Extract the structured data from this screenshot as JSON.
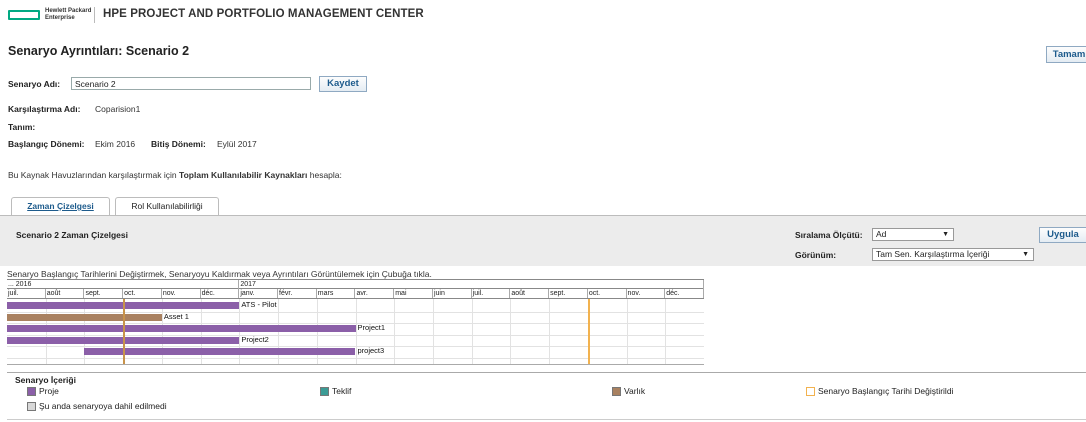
{
  "header": {
    "logo_text_line1": "Hewlett Packard",
    "logo_text_line2": "Enterprise",
    "app_title": "HPE PROJECT AND PORTFOLIO MANAGEMENT CENTER"
  },
  "page": {
    "title": "Senaryo Ayrıntıları: Scenario 2",
    "ok_button": "Tamam"
  },
  "scenario_name": {
    "label": "Senaryo Adı:",
    "value": "Scenario 2",
    "save_button": "Kaydet"
  },
  "details": {
    "comparison_label": "Karşılaştırma Adı:",
    "comparison_value": "Coparision1",
    "description_label": "Tanım:",
    "start_label": "Başlangıç Dönemi:",
    "start_value": "Ekim 2016",
    "end_label": "Bitiş Dönemi:",
    "end_value": "Eylül 2017"
  },
  "calc_sentence": {
    "prefix": "Bu Kaynak Havuzlarından karşılaştırmak için",
    "bold": "Toplam Kullanılabilir Kaynakları",
    "suffix": "hesapla:"
  },
  "tabs": [
    {
      "label": "Zaman Çizelgesi",
      "active": true
    },
    {
      "label": "Rol Kullanılabilirliği",
      "active": false
    }
  ],
  "panel": {
    "title": "Scenario 2 Zaman Çizelgesi",
    "sort_label": "Sıralama Ölçütü:",
    "sort_value": "Ad",
    "apply_button": "Uygula",
    "view_label": "Görünüm:",
    "view_value": "Tam Sen. Karşılaştırma İçeriği"
  },
  "gantt": {
    "instruction": "Senaryo Başlangıç Tarihlerini Değiştirmek, Senaryoyu Kaldırmak veya Ayrıntıları Görüntülemek için Çubuğa tıkla.",
    "years": [
      {
        "label": "... 2016",
        "months": 6
      },
      {
        "label": "2017",
        "months": 12
      }
    ],
    "months": [
      "juil.",
      "août",
      "sept.",
      "oct.",
      "nov.",
      "déc.",
      "janv.",
      "févr.",
      "mars",
      "avr.",
      "mai",
      "juin",
      "juil.",
      "août",
      "sept.",
      "oct.",
      "nov.",
      "déc."
    ],
    "rows": [
      {
        "label": "ATS - Pilot",
        "type": "Proje",
        "start": 0,
        "end": 6.0
      },
      {
        "label": "Asset 1",
        "type": "Varlık",
        "start": 0,
        "end": 4.0
      },
      {
        "label": "Project1",
        "type": "Proje",
        "start": 0,
        "end": 9.0
      },
      {
        "label": "Project2",
        "type": "Proje",
        "start": 0,
        "end": 6.0
      },
      {
        "label": "project3",
        "type": "Proje",
        "start": 2.0,
        "end": 9.0
      }
    ],
    "markers": [
      {
        "month": 3.0,
        "color": "#c8934a"
      },
      {
        "month": 15.0,
        "color": "#f2b24f"
      }
    ]
  },
  "legend": {
    "title": "Senaryo İçeriği",
    "items": [
      {
        "label": "Proje",
        "color": "#8b5fa8",
        "icon": "project-swatch"
      },
      {
        "label": "Teklif",
        "color": "#3b9b95",
        "icon": "proposal-swatch"
      },
      {
        "label": "Varlık",
        "color": "#a98160",
        "icon": "asset-swatch"
      },
      {
        "label": "Senaryo Başlangıç Tarihi Değiştirildi",
        "color": "#f2b24f",
        "icon": "start-changed-swatch"
      },
      {
        "label": "Şu anda senaryoya dahil edilmedi",
        "color": "#d8d8d8",
        "icon": "excluded-swatch"
      }
    ]
  },
  "colors": {
    "project": "#8b5fa8",
    "asset": "#a98160",
    "accent": "#1d5b8c",
    "brand": "#01a982"
  }
}
